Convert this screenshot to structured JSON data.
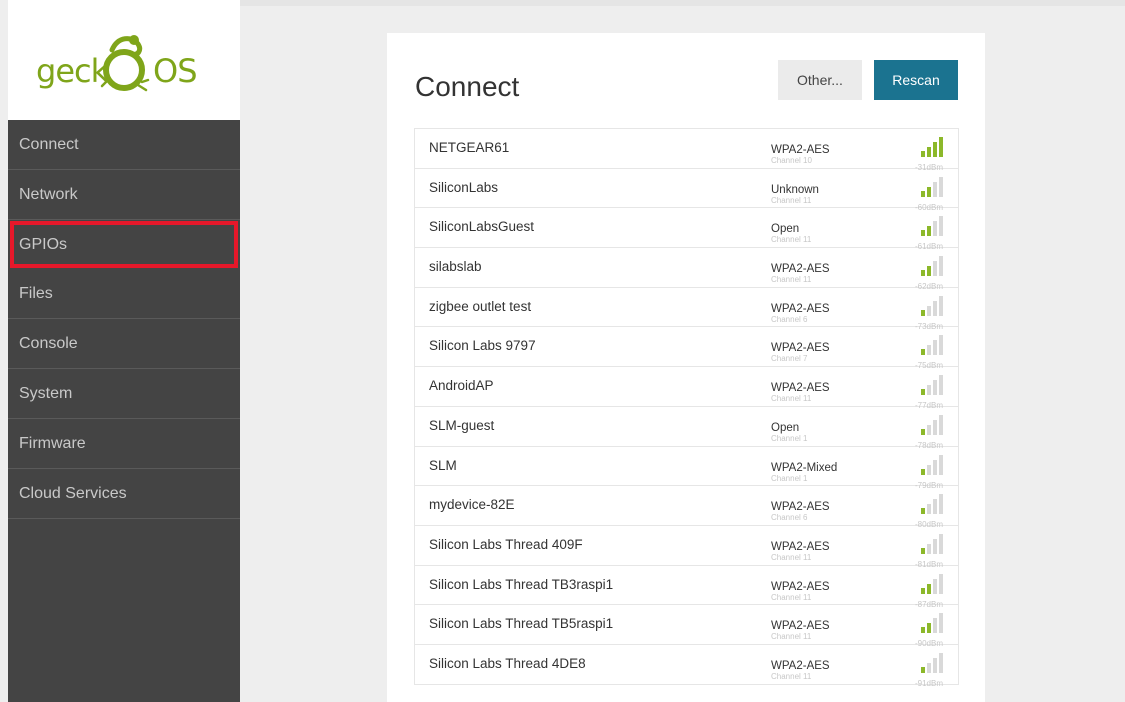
{
  "logo": {
    "text_left": "geck",
    "text_right": "OS",
    "icon": "gecko-icon"
  },
  "nav": [
    {
      "label": "Connect",
      "highlight": false
    },
    {
      "label": "Network",
      "highlight": false
    },
    {
      "label": "GPIOs",
      "highlight": true
    },
    {
      "label": "Files",
      "highlight": false
    },
    {
      "label": "Console",
      "highlight": false
    },
    {
      "label": "System",
      "highlight": false
    },
    {
      "label": "Firmware",
      "highlight": false
    },
    {
      "label": "Cloud Services",
      "highlight": false
    }
  ],
  "page": {
    "title": "Connect",
    "other_label": "Other...",
    "rescan_label": "Rescan"
  },
  "colors": {
    "accent": "#1b7390",
    "signal_on": "#8cb82a",
    "signal_off": "#d9d9d9",
    "highlight": "#e6182a"
  },
  "networks": [
    {
      "ssid": "NETGEAR61",
      "security": "WPA2-AES",
      "channel": "Channel 10",
      "dbm": "-31dBm",
      "bars": 4
    },
    {
      "ssid": "SiliconLabs",
      "security": "Unknown",
      "channel": "Channel 11",
      "dbm": "-60dBm",
      "bars": 2
    },
    {
      "ssid": "SiliconLabsGuest",
      "security": "Open",
      "channel": "Channel 11",
      "dbm": "-61dBm",
      "bars": 2
    },
    {
      "ssid": "silabslab",
      "security": "WPA2-AES",
      "channel": "Channel 11",
      "dbm": "-62dBm",
      "bars": 2
    },
    {
      "ssid": "zigbee outlet test",
      "security": "WPA2-AES",
      "channel": "Channel 6",
      "dbm": "-73dBm",
      "bars": 1
    },
    {
      "ssid": "Silicon Labs 9797",
      "security": "WPA2-AES",
      "channel": "Channel 7",
      "dbm": "-75dBm",
      "bars": 1
    },
    {
      "ssid": "AndroidAP",
      "security": "WPA2-AES",
      "channel": "Channel 11",
      "dbm": "-77dBm",
      "bars": 1
    },
    {
      "ssid": "SLM-guest",
      "security": "Open",
      "channel": "Channel 1",
      "dbm": "-78dBm",
      "bars": 1
    },
    {
      "ssid": "SLM",
      "security": "WPA2-Mixed",
      "channel": "Channel 1",
      "dbm": "-79dBm",
      "bars": 1
    },
    {
      "ssid": "mydevice-82E",
      "security": "WPA2-AES",
      "channel": "Channel 6",
      "dbm": "-80dBm",
      "bars": 1
    },
    {
      "ssid": "Silicon Labs Thread 409F",
      "security": "WPA2-AES",
      "channel": "Channel 11",
      "dbm": "-81dBm",
      "bars": 1
    },
    {
      "ssid": "Silicon Labs Thread TB3raspi1",
      "security": "WPA2-AES",
      "channel": "Channel 11",
      "dbm": "-87dBm",
      "bars": 2
    },
    {
      "ssid": "Silicon Labs Thread TB5raspi1",
      "security": "WPA2-AES",
      "channel": "Channel 11",
      "dbm": "-90dBm",
      "bars": 2
    },
    {
      "ssid": "Silicon Labs Thread 4DE8",
      "security": "WPA2-AES",
      "channel": "Channel 11",
      "dbm": "-91dBm",
      "bars": 1
    }
  ]
}
